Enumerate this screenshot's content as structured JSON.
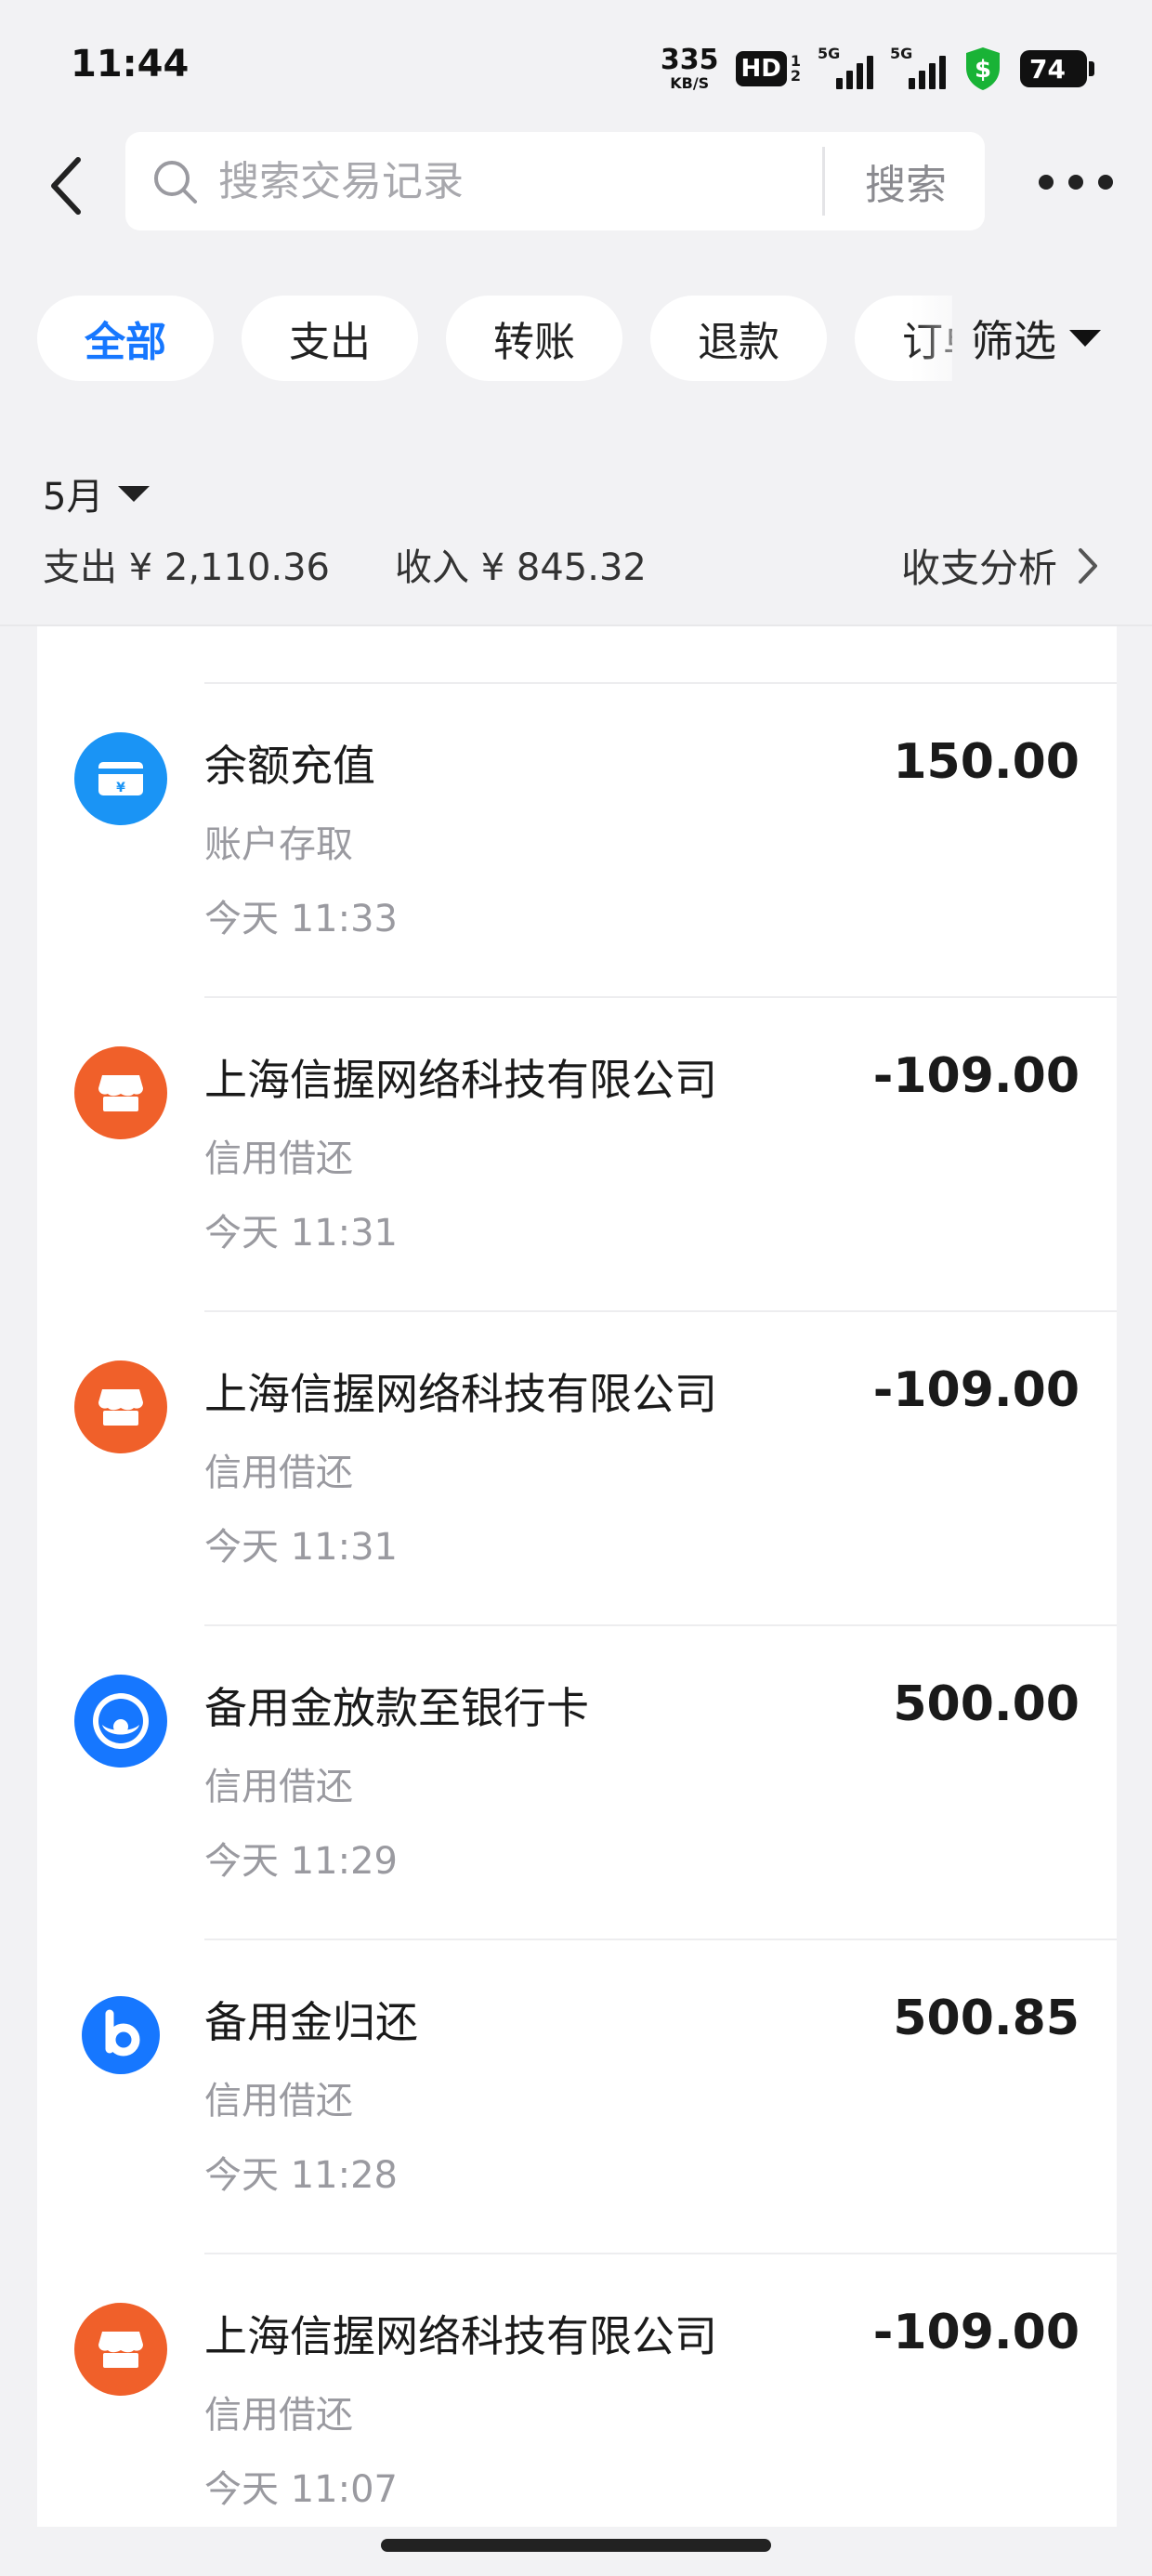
{
  "status_bar": {
    "time": "11:44",
    "net_speed": "335",
    "net_unit": "KB/S",
    "hd_label": "HD",
    "hd_sub_1": "1",
    "hd_sub_2": "2",
    "signal_1": "5G",
    "signal_2": "5G",
    "battery": "74"
  },
  "header": {
    "search_placeholder": "搜索交易记录",
    "search_button": "搜索"
  },
  "tabs": [
    {
      "label": "全部",
      "active": true
    },
    {
      "label": "支出",
      "active": false
    },
    {
      "label": "转账",
      "active": false
    },
    {
      "label": "退款",
      "active": false
    },
    {
      "label": "订单",
      "active": false
    }
  ],
  "filter": {
    "label": "筛选"
  },
  "summary": {
    "month": "5月",
    "expense": "支出 ¥ 2,110.36",
    "income": "收入 ¥ 845.32",
    "analysis_link": "收支分析"
  },
  "transactions": [
    {
      "title": "余额充值",
      "category": "账户存取",
      "time": "今天 11:33",
      "amount": "150.00",
      "icon": "balance-card-icon",
      "icon_color": "#1a94f5"
    },
    {
      "title": "上海信握网络科技有限公司",
      "category": "信用借还",
      "time": "今天 11:31",
      "amount": "-109.00",
      "icon": "store-icon",
      "icon_color": "#f0602a"
    },
    {
      "title": "上海信握网络科技有限公司",
      "category": "信用借还",
      "time": "今天 11:31",
      "amount": "-109.00",
      "icon": "store-icon",
      "icon_color": "#f0602a"
    },
    {
      "title": "备用金放款至银行卡",
      "category": "信用借还",
      "time": "今天 11:29",
      "amount": "500.00",
      "icon": "reserve-fund-icon",
      "icon_color": "#1677ff"
    },
    {
      "title": "备用金归还",
      "category": "信用借还",
      "time": "今天 11:28",
      "amount": "500.85",
      "icon": "b-logo-icon",
      "icon_color": "#1677ff"
    },
    {
      "title": "上海信握网络科技有限公司",
      "category": "信用借还",
      "time": "今天 11:07",
      "amount": "-109.00",
      "icon": "store-icon",
      "icon_color": "#f0602a"
    }
  ],
  "colors": {
    "accent": "#1677ff",
    "background": "#f2f2f4",
    "secondary_text": "#9a9aa0",
    "shield_green": "#19b336"
  }
}
